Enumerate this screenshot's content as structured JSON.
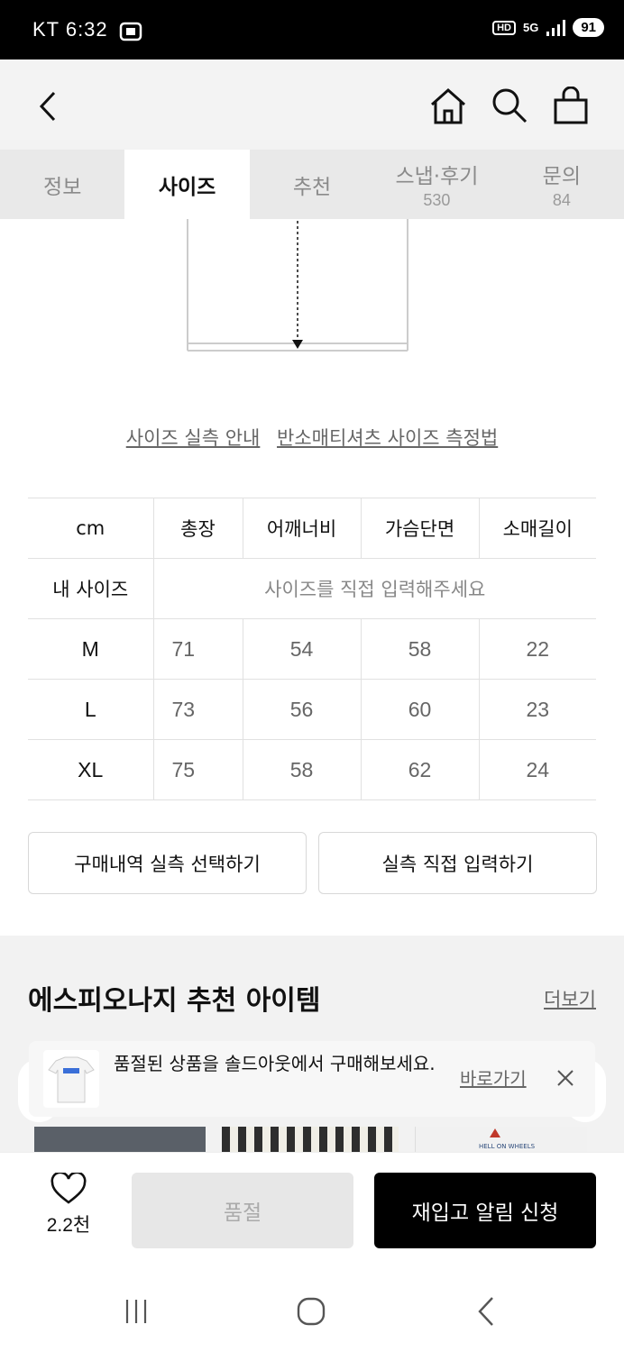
{
  "status_bar": {
    "carrier_time": "KT 6:32",
    "hd": "HD",
    "network": "5G",
    "battery": "91"
  },
  "tabs": [
    {
      "label": "정보",
      "count": ""
    },
    {
      "label": "사이즈",
      "count": ""
    },
    {
      "label": "추천",
      "count": ""
    },
    {
      "label": "스냅·후기",
      "count": "530"
    },
    {
      "label": "문의",
      "count": "84"
    }
  ],
  "guides": {
    "link1": "사이즈 실측 안내",
    "link2": "반소매티셔츠 사이즈 측정법"
  },
  "size_table": {
    "headers": [
      "cm",
      "총장",
      "어깨너비",
      "가슴단면",
      "소매길이"
    ],
    "my_size_label": "내 사이즈",
    "my_size_hint": "사이즈를 직접 입력해주세요",
    "rows": [
      {
        "size": "M",
        "values": [
          "71",
          "54",
          "58",
          "22"
        ]
      },
      {
        "size": "L",
        "values": [
          "73",
          "56",
          "60",
          "23"
        ]
      },
      {
        "size": "XL",
        "values": [
          "75",
          "58",
          "62",
          "24"
        ]
      }
    ]
  },
  "actions": {
    "purchase_history": "구매내역 실측 선택하기",
    "direct_input": "실측 직접 입력하기"
  },
  "recommend": {
    "title": "에스피오나지 추천 아이템",
    "more": "더보기"
  },
  "toast": {
    "message": "품절된 상품을 솔드아웃에서 구매해보세요.",
    "link": "바로가기"
  },
  "bottom_bar": {
    "like_count": "2.2천",
    "soldout": "품절",
    "restock": "재입고 알림 신청"
  }
}
